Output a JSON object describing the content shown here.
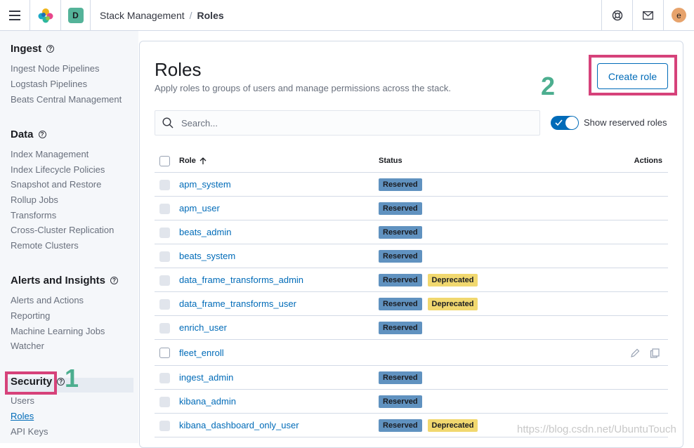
{
  "header": {
    "space_initial": "D",
    "breadcrumbs": [
      "Stack Management",
      "Roles"
    ],
    "user_initial": "e"
  },
  "sidebar": {
    "sections": [
      {
        "title": "Ingest",
        "items": [
          "Ingest Node Pipelines",
          "Logstash Pipelines",
          "Beats Central Management"
        ]
      },
      {
        "title": "Data",
        "items": [
          "Index Management",
          "Index Lifecycle Policies",
          "Snapshot and Restore",
          "Rollup Jobs",
          "Transforms",
          "Cross-Cluster Replication",
          "Remote Clusters"
        ]
      },
      {
        "title": "Alerts and Insights",
        "items": [
          "Alerts and Actions",
          "Reporting",
          "Machine Learning Jobs",
          "Watcher"
        ]
      },
      {
        "title": "Security",
        "items": [
          "Users",
          "Roles",
          "API Keys"
        ]
      }
    ],
    "selected": "Roles"
  },
  "main": {
    "title": "Roles",
    "subtitle": "Apply roles to groups of users and manage permissions across the stack.",
    "create_label": "Create role",
    "search_placeholder": "Search...",
    "toggle_label": "Show reserved roles",
    "toggle_on": true,
    "columns": {
      "role": "Role",
      "status": "Status",
      "actions": "Actions"
    },
    "rows": [
      {
        "name": "apm_system",
        "badges": [
          "Reserved"
        ]
      },
      {
        "name": "apm_user",
        "badges": [
          "Reserved"
        ]
      },
      {
        "name": "beats_admin",
        "badges": [
          "Reserved"
        ]
      },
      {
        "name": "beats_system",
        "badges": [
          "Reserved"
        ]
      },
      {
        "name": "data_frame_transforms_admin",
        "badges": [
          "Reserved",
          "Deprecated"
        ]
      },
      {
        "name": "data_frame_transforms_user",
        "badges": [
          "Reserved",
          "Deprecated"
        ]
      },
      {
        "name": "enrich_user",
        "badges": [
          "Reserved"
        ]
      },
      {
        "name": "fleet_enroll",
        "badges": [],
        "editable": true
      },
      {
        "name": "ingest_admin",
        "badges": [
          "Reserved"
        ]
      },
      {
        "name": "kibana_admin",
        "badges": [
          "Reserved"
        ]
      },
      {
        "name": "kibana_dashboard_only_user",
        "badges": [
          "Reserved",
          "Deprecated"
        ]
      }
    ]
  },
  "annotations": {
    "step1": "1",
    "step2": "2"
  },
  "watermark": "https://blog.csdn.net/UbuntuTouch",
  "colors": {
    "accent": "#006bb8",
    "reserved_badge": "#6092c0",
    "deprecated_badge": "#f1d86f",
    "highlight": "#d6427a",
    "step_number": "#4cae8f"
  }
}
